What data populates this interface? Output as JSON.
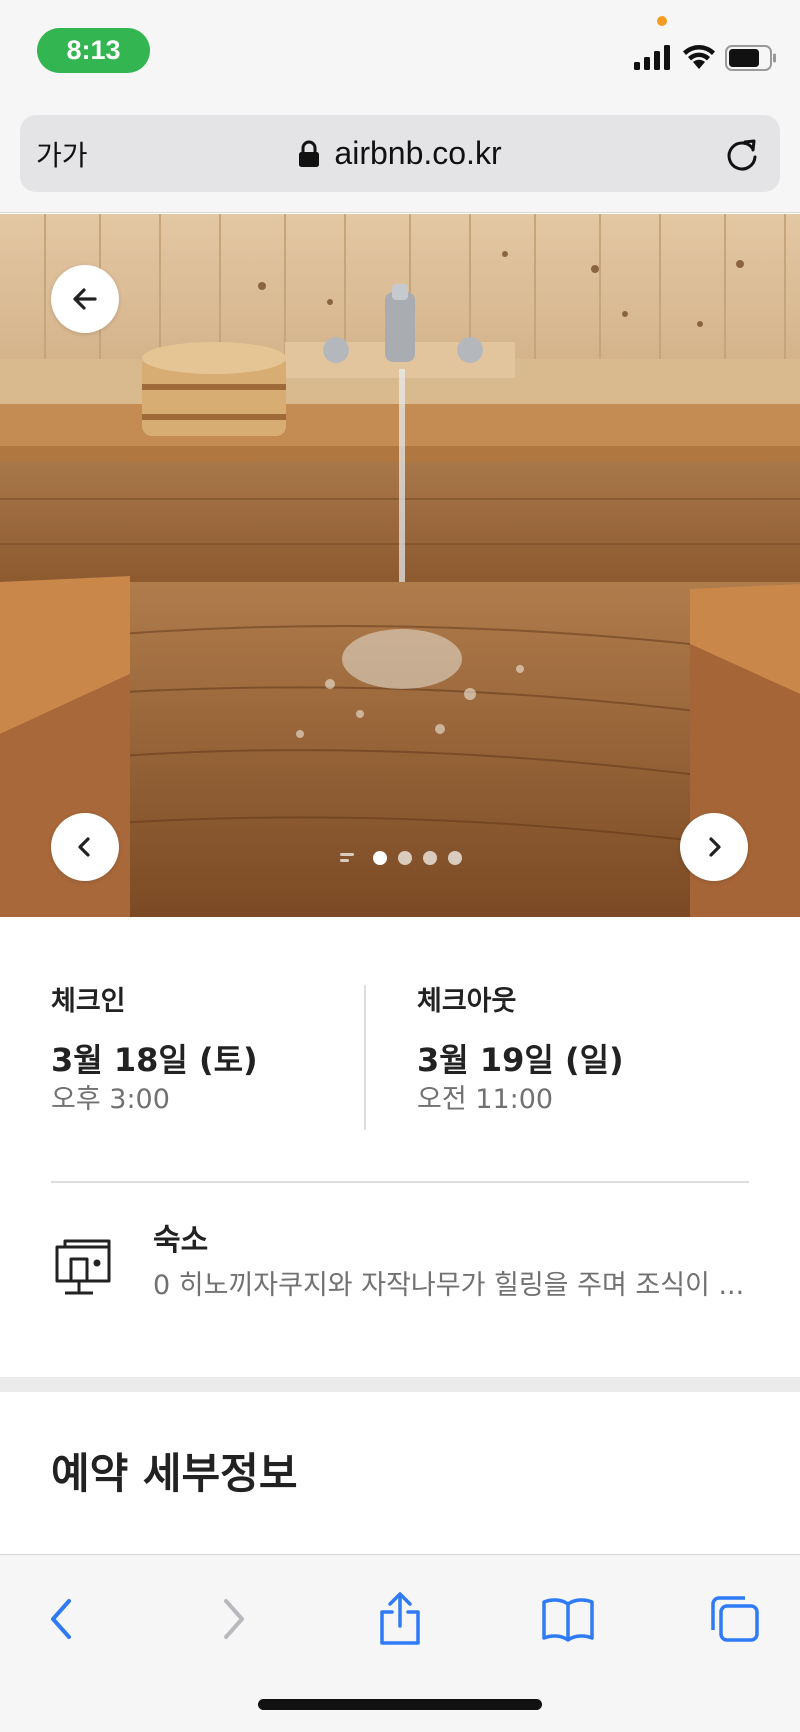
{
  "status_bar": {
    "time": "8:13",
    "time_pill_color": "#33b551",
    "icons": [
      "signal-icon",
      "wifi-icon",
      "battery-icon"
    ]
  },
  "url_bar": {
    "text_size_label": "가가",
    "url": "airbnb.co.kr",
    "icons": [
      "lock-icon",
      "reload-icon"
    ]
  },
  "photo": {
    "description_icons": [
      "back-arrow-icon",
      "chevron-left-icon",
      "chevron-right-icon"
    ],
    "dots_count": 4,
    "active_dot": 0
  },
  "checkin": {
    "label": "체크인",
    "date": "3월 18일 (토)",
    "time": "오후 3:00"
  },
  "checkout": {
    "label": "체크아웃",
    "date": "3월 19일 (일)",
    "time": "오전 11:00"
  },
  "property": {
    "title": "숙소",
    "description": "0 히노끼자쿠지와 자작나무가 힐링을 주며 조식이 ...",
    "icon": "building-icon"
  },
  "reservation_details": {
    "heading": "예약 세부정보"
  },
  "toolbar": {
    "icons": [
      "back-icon",
      "forward-icon",
      "share-icon",
      "bookmarks-icon",
      "tabs-icon"
    ],
    "accent_color": "#2f7bf6",
    "disabled_color": "#b9b9bd"
  }
}
